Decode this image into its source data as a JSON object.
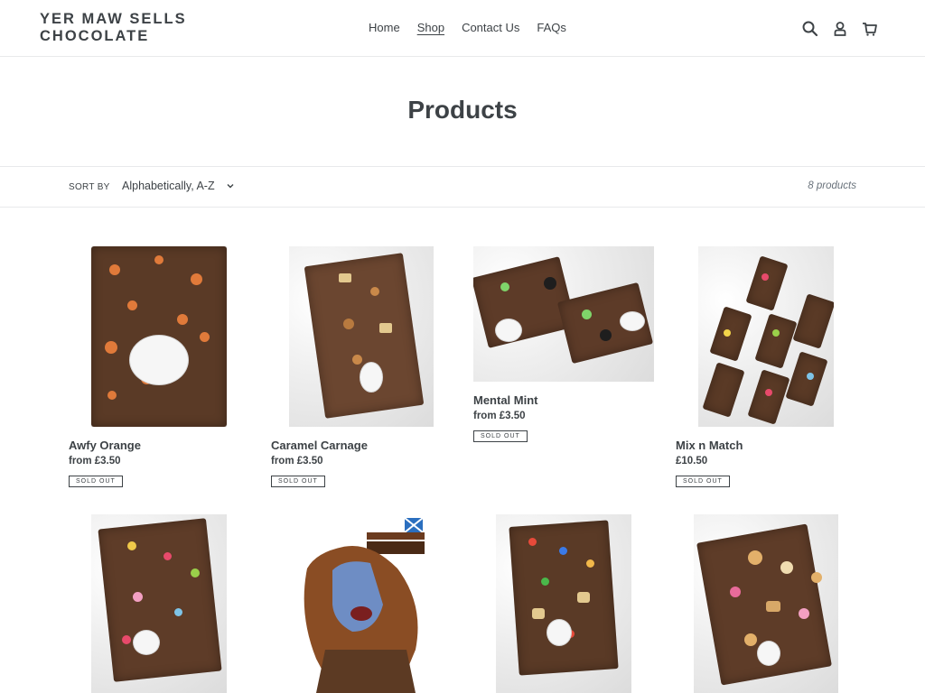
{
  "header": {
    "logo_line1": "YER MAW SELLS",
    "logo_line2": "CHOCOLATE",
    "nav": [
      {
        "label": "Home"
      },
      {
        "label": "Shop"
      },
      {
        "label": "Contact Us"
      },
      {
        "label": "FAQs"
      }
    ],
    "active_nav": "Shop",
    "icons": [
      "search-icon",
      "account-icon",
      "cart-icon"
    ]
  },
  "page": {
    "title": "Products"
  },
  "filter": {
    "sort_label": "Sort by",
    "sort_value": "Alphabetically, A-Z",
    "count": "8 products"
  },
  "products": [
    {
      "name": "Awfy Orange",
      "price": "from £3.50",
      "badge": "Sold out"
    },
    {
      "name": "Caramel Carnage",
      "price": "from £3.50",
      "badge": "Sold out"
    },
    {
      "name": "Mental Mint",
      "price": "from £3.50",
      "badge": "Sold out"
    },
    {
      "name": "Mix n Match",
      "price": "£10.50",
      "badge": "Sold out"
    },
    {
      "name": "",
      "price": "",
      "badge": ""
    },
    {
      "name": "",
      "price": "",
      "badge": ""
    },
    {
      "name": "",
      "price": "",
      "badge": ""
    },
    {
      "name": "",
      "price": "",
      "badge": ""
    }
  ],
  "colors": {
    "text": "#3d4246",
    "border": "#e8e9eb",
    "chocolate": "#5a3a26"
  }
}
